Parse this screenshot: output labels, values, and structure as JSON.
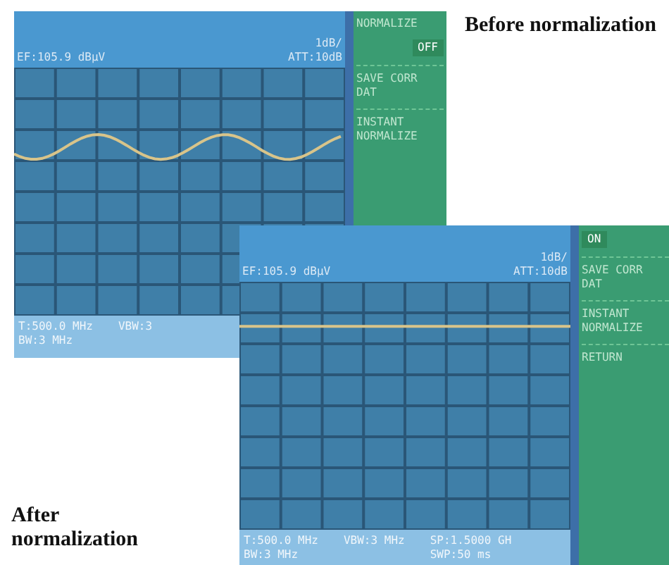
{
  "screens": [
    {
      "caption": "Before normalization",
      "header": {
        "ref": "EF:105.9 dBμV",
        "scale": "1dB/",
        "att": "ATT:10dB"
      },
      "trace": {
        "kind": "wavy"
      },
      "footer": {
        "left": [
          "T:500.0 MHz",
          "BW:3 MHz"
        ],
        "right": [
          "VBW:3"
        ]
      },
      "softkeys": [
        {
          "kind": "title",
          "label": "NORMALIZE"
        },
        {
          "kind": "toggle",
          "label": "OFF",
          "selected": true
        },
        {
          "kind": "key",
          "label": "SAVE CORR DAT"
        },
        {
          "kind": "key",
          "label": "INSTANT NORMALIZE"
        }
      ]
    },
    {
      "caption": "After normalization",
      "header": {
        "ref": "EF:105.9 dBμV",
        "scale": "1dB/",
        "att": "ATT:10dB"
      },
      "trace": {
        "kind": "flat"
      },
      "footer": {
        "left": [
          "T:500.0 MHz",
          "BW:3 MHz"
        ],
        "right": [
          "VBW:3 MHz"
        ],
        "far": [
          "SP:1.5000 GH",
          "SWP:50 ms"
        ]
      },
      "softkeys": [
        {
          "kind": "toggle",
          "label": "ON",
          "selected": true
        },
        {
          "kind": "key",
          "label": "SAVE CORR DAT"
        },
        {
          "kind": "key",
          "label": "INSTANT NORMALIZE"
        },
        {
          "kind": "key",
          "label": "RETURN"
        }
      ]
    }
  ]
}
